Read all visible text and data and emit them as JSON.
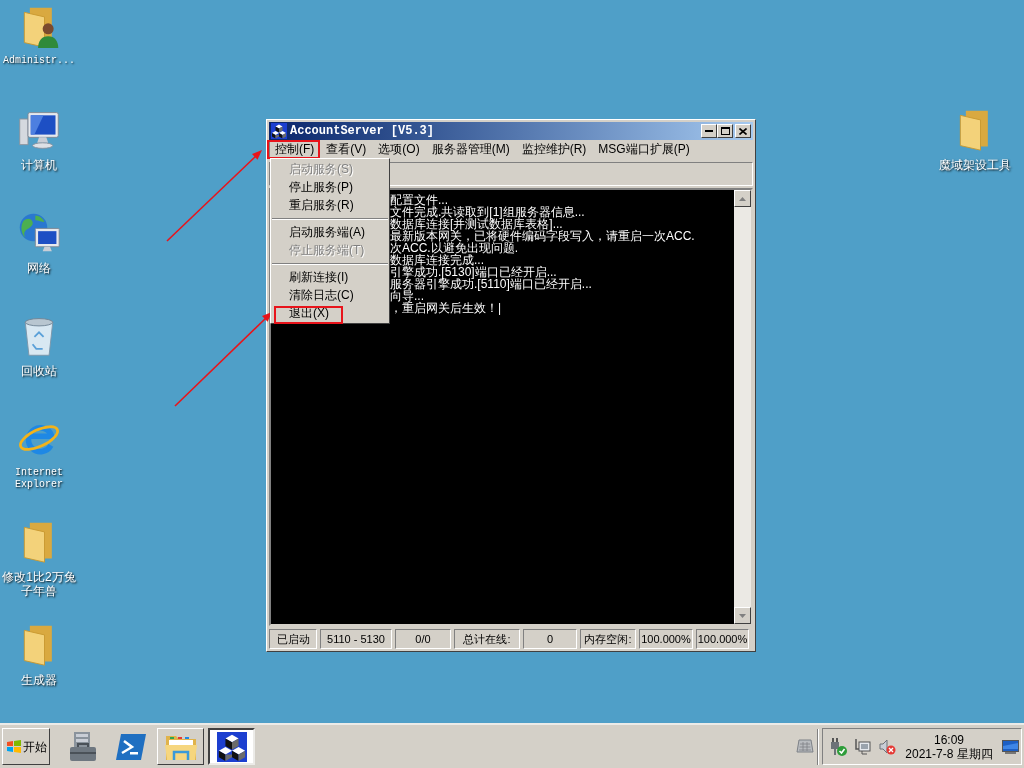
{
  "desktop": {
    "icons": [
      {
        "kind": "user-folder",
        "label": "Administr..."
      },
      {
        "kind": "computer",
        "label": "计算机"
      },
      {
        "kind": "network",
        "label": "网络"
      },
      {
        "kind": "recycle-bin",
        "label": "回收站"
      },
      {
        "kind": "browser",
        "label": "Internet Explorer"
      },
      {
        "kind": "folder",
        "label": "修改1比2万兔子年兽"
      },
      {
        "kind": "folder",
        "label": "生成器"
      }
    ],
    "right_icons": [
      {
        "kind": "folder",
        "label": "魔域架设工具"
      }
    ]
  },
  "window": {
    "title": "AccountServer [V5.3]",
    "menu": [
      {
        "label": "控制(F)",
        "open": true,
        "highlighted": true,
        "items": [
          {
            "kind": "item",
            "label": "启动服务(S)",
            "disabled": true,
            "highlighted": false
          },
          {
            "kind": "item",
            "label": "停止服务(P)",
            "disabled": false,
            "highlighted": false
          },
          {
            "kind": "item",
            "label": "重启服务(R)",
            "disabled": false,
            "highlighted": false
          },
          {
            "kind": "separator"
          },
          {
            "kind": "item",
            "label": "启动服务端(A)",
            "disabled": false,
            "highlighted": false
          },
          {
            "kind": "item",
            "label": "停止服务端(T)",
            "disabled": true,
            "highlighted": false
          },
          {
            "kind": "separator"
          },
          {
            "kind": "item",
            "label": "刷新连接(I)",
            "disabled": false,
            "highlighted": false
          },
          {
            "kind": "item",
            "label": "清除日志(C)",
            "disabled": false,
            "highlighted": false
          },
          {
            "kind": "item",
            "label": "退出(X)",
            "disabled": false,
            "highlighted": true
          }
        ]
      },
      {
        "label": "查看(V)",
        "open": false,
        "highlighted": false
      },
      {
        "label": "选项(O)",
        "open": false,
        "highlighted": false
      },
      {
        "label": "服务器管理(M)",
        "open": false,
        "highlighted": false
      },
      {
        "label": "监控维护(R)",
        "open": false,
        "highlighted": false
      },
      {
        "label": "MSG端口扩展(P)",
        "open": false,
        "highlighted": false
      }
    ],
    "console_lines": [
      "配置文件...",
      "文件完成.共读取到[1]组服务器信息...",
      "数据库连接[并测试数据库表格]...",
      "最新版本网关，已将硬件编码字段写入，请重启一次ACC.",
      "次ACC.以避免出现问题.",
      "数据库连接完成...",
      "引擎成功.[5130]端口已经开启...",
      "服务器引擎成功.[5110]端口已经开启...",
      "向导...",
      "，重启网关后生效！|"
    ],
    "status_bar": [
      "已启动",
      "5110 - 5130",
      "0/0",
      "总计在线:",
      "0",
      "内存空闲:",
      "100.000%",
      "100.000%"
    ]
  },
  "taskbar": {
    "start": "开始",
    "tasks": [
      {
        "kind": "folder",
        "selected": false
      },
      {
        "kind": "app",
        "selected": true
      }
    ],
    "clock": {
      "time": "16:09",
      "date": "2021-7-8 星期四"
    }
  }
}
